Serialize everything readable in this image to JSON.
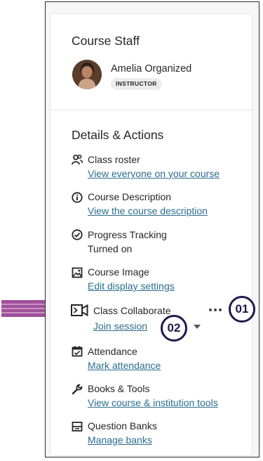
{
  "course_staff": {
    "title": "Course Staff",
    "member": {
      "name": "Amelia Organized",
      "role": "INSTRUCTOR"
    }
  },
  "details": {
    "title": "Details & Actions",
    "items": [
      {
        "title": "Class roster",
        "link": "View everyone on your course",
        "icon": "people-icon"
      },
      {
        "title": "Course Description",
        "link": "View the course description",
        "icon": "info-icon"
      },
      {
        "title": "Progress Tracking",
        "status": "Turned on",
        "icon": "check-circle-icon"
      },
      {
        "title": "Course Image",
        "link": "Edit display settings",
        "icon": "image-icon"
      },
      {
        "title": "Class Collaborate",
        "link": "Join session",
        "icon": "video-camera-icon"
      },
      {
        "title": "Attendance",
        "link": "Mark attendance",
        "icon": "calendar-icon"
      },
      {
        "title": "Books & Tools",
        "link": "View course & institution tools",
        "icon": "wrench-icon"
      },
      {
        "title": "Question Banks",
        "link": "Manage banks",
        "icon": "question-bank-icon"
      }
    ]
  },
  "callouts": {
    "first": "01",
    "second": "02"
  },
  "colors": {
    "link": "#2b6d8f",
    "callout": "#1b1a4e",
    "arrow": "#a0509a"
  }
}
